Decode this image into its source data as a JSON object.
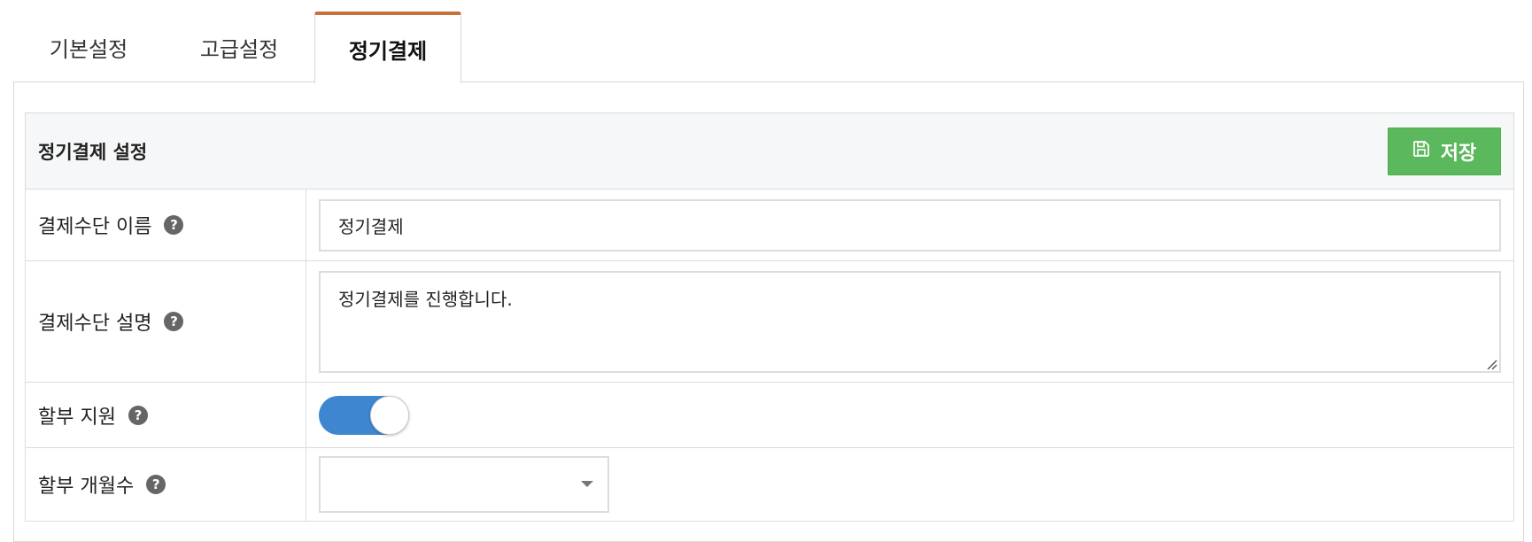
{
  "tabs": [
    {
      "label": "기본설정",
      "active": false
    },
    {
      "label": "고급설정",
      "active": false
    },
    {
      "label": "정기결제",
      "active": true
    }
  ],
  "colors": {
    "active_tab_accent": "#c8703a",
    "save_button": "#5cb85c",
    "toggle_on": "#3f86d0"
  },
  "section": {
    "title": "정기결제 설정",
    "save_button": {
      "label": "저장",
      "icon": "floppy-disk-icon"
    }
  },
  "fields": {
    "payment_name": {
      "label": "결제수단 이름",
      "value": "정기결제",
      "help_icon": "question-circle-icon"
    },
    "payment_description": {
      "label": "결제수단 설명",
      "value": "정기결제를 진행합니다.",
      "help_icon": "question-circle-icon"
    },
    "installment_support": {
      "label": "할부 지원",
      "enabled": true,
      "help_icon": "question-circle-icon"
    },
    "installment_months": {
      "label": "할부 개월수",
      "selected": "",
      "help_icon": "question-circle-icon"
    }
  }
}
